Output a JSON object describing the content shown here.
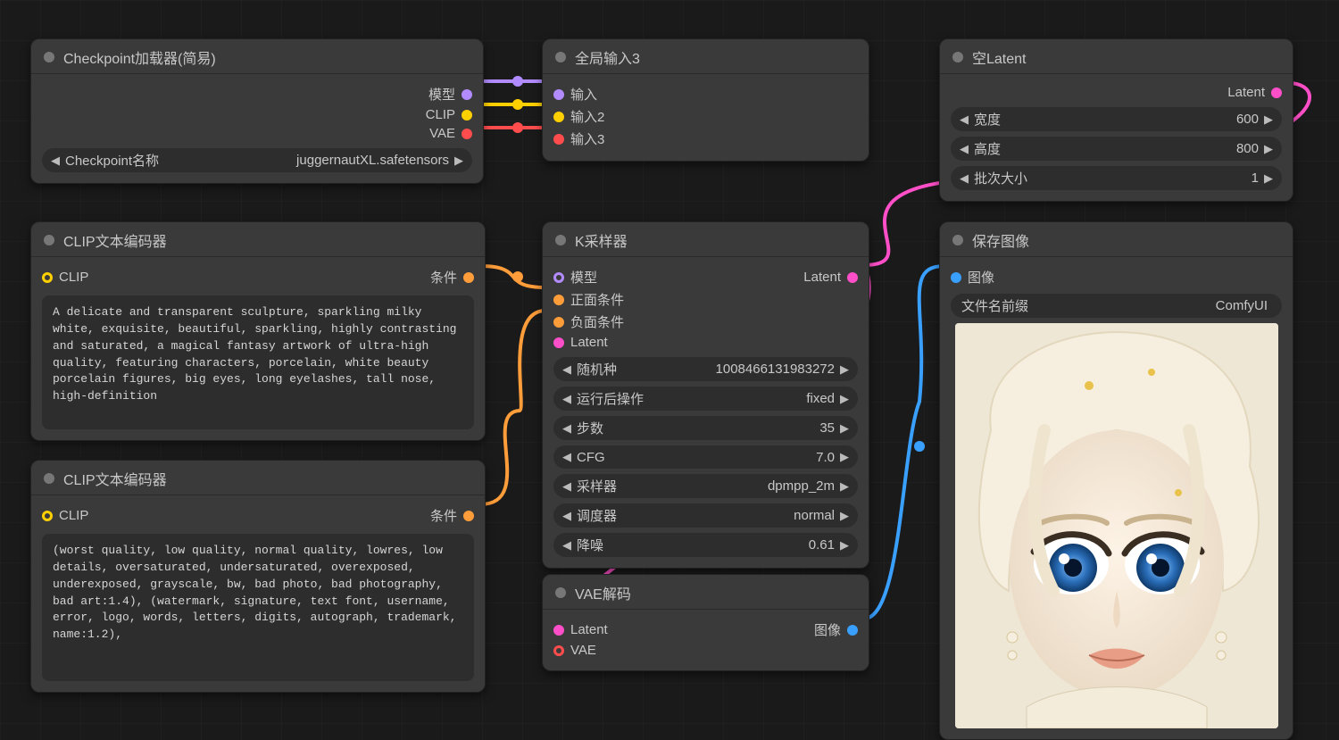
{
  "nodes": {
    "checkpoint": {
      "title": "Checkpoint加载器(简易)",
      "outputs": {
        "model": "模型",
        "clip": "CLIP",
        "vae": "VAE"
      },
      "widget": {
        "label": "Checkpoint名称",
        "value": "juggernautXL.safetensors"
      }
    },
    "global_input": {
      "title": "全局输入3",
      "inputs": {
        "in1": "输入",
        "in2": "输入2",
        "in3": "输入3"
      }
    },
    "empty_latent": {
      "title": "空Latent",
      "output": "Latent",
      "widgets": [
        {
          "label": "宽度",
          "value": "600"
        },
        {
          "label": "高度",
          "value": "800"
        },
        {
          "label": "批次大小",
          "value": "1"
        }
      ]
    },
    "clip_pos": {
      "title": "CLIP文本编码器",
      "input": "CLIP",
      "output": "条件",
      "text": "A delicate and transparent sculpture, sparkling milky white, exquisite, beautiful, sparkling, highly contrasting and saturated, a magical fantasy artwork of ultra-high quality, featuring characters, porcelain, white beauty porcelain figures, big eyes, long eyelashes, tall nose, high-definition"
    },
    "clip_neg": {
      "title": "CLIP文本编码器",
      "input": "CLIP",
      "output": "条件",
      "text": "(worst quality, low quality, normal quality, lowres, low details, oversaturated, undersaturated, overexposed, underexposed, grayscale, bw, bad photo, bad photography, bad art:1.4), (watermark, signature, text font, username, error, logo, words, letters, digits, autograph, trademark, name:1.2),"
    },
    "ksampler": {
      "title": "K采样器",
      "inputs": {
        "model": "模型",
        "positive": "正面条件",
        "negative": "负面条件",
        "latent": "Latent"
      },
      "output": "Latent",
      "widgets": [
        {
          "label": "随机种",
          "value": "1008466131983272"
        },
        {
          "label": "运行后操作",
          "value": "fixed"
        },
        {
          "label": "步数",
          "value": "35"
        },
        {
          "label": "CFG",
          "value": "7.0"
        },
        {
          "label": "采样器",
          "value": "dpmpp_2m"
        },
        {
          "label": "调度器",
          "value": "normal"
        },
        {
          "label": "降噪",
          "value": "0.61"
        }
      ]
    },
    "vae_decode": {
      "title": "VAE解码",
      "inputs": {
        "latent": "Latent",
        "vae": "VAE"
      },
      "output": "图像"
    },
    "save_image": {
      "title": "保存图像",
      "input": "图像",
      "widget": {
        "label": "文件名前缀",
        "value": "ComfyUI"
      }
    }
  }
}
